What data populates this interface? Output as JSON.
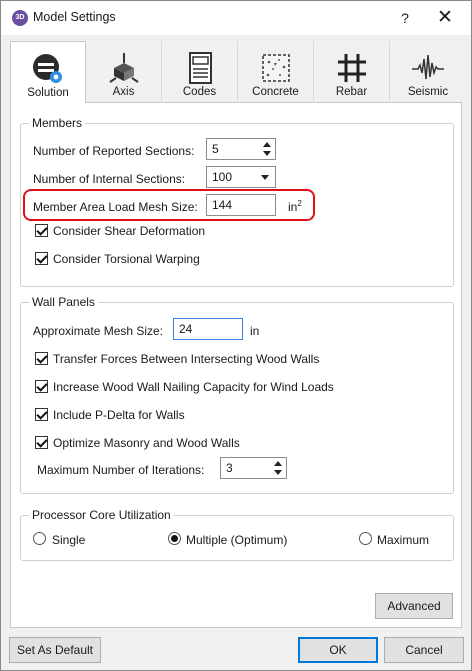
{
  "window": {
    "title": "Model Settings",
    "app_icon_text": "3D",
    "help_glyph": "?",
    "close_glyph": "✕"
  },
  "tabs": [
    {
      "label": "Solution",
      "icon": "solution-gear-icon",
      "active": true
    },
    {
      "label": "Axis",
      "icon": "axis-cube-icon",
      "active": false
    },
    {
      "label": "Codes",
      "icon": "codes-book-icon",
      "active": false
    },
    {
      "label": "Concrete",
      "icon": "concrete-block-icon",
      "active": false
    },
    {
      "label": "Rebar",
      "icon": "rebar-grid-icon",
      "active": false
    },
    {
      "label": "Seismic",
      "icon": "seismic-wave-icon",
      "active": false
    }
  ],
  "members": {
    "legend": "Members",
    "reported_sections_label": "Number of Reported Sections:",
    "reported_sections_value": "5",
    "internal_sections_label": "Number of Internal Sections:",
    "internal_sections_value": "100",
    "mesh_size_label": "Member Area Load Mesh Size:",
    "mesh_size_value": "144",
    "mesh_size_unit": "in",
    "mesh_size_unit_sup": "2",
    "shear_deformation_label": "Consider Shear Deformation",
    "shear_deformation_checked": true,
    "torsional_warping_label": "Consider Torsional Warping",
    "torsional_warping_checked": true
  },
  "wall_panels": {
    "legend": "Wall Panels",
    "mesh_size_label": "Approximate Mesh Size:",
    "mesh_size_value": "24",
    "mesh_size_unit": "in",
    "transfer_forces_label": "Transfer Forces Between Intersecting Wood Walls",
    "increase_nailing_label": "Increase Wood Wall Nailing Capacity for Wind Loads",
    "p_delta_label": "Include P-Delta for Walls",
    "optimize_label": "Optimize Masonry and Wood Walls",
    "max_iterations_label": "Maximum Number of Iterations:",
    "max_iterations_value": "3"
  },
  "processor": {
    "legend": "Processor Core Utilization",
    "options": [
      "Single",
      "Multiple (Optimum)",
      "Maximum"
    ],
    "selected": "Multiple (Optimum)"
  },
  "buttons": {
    "advanced": "Advanced",
    "set_default": "Set As Default",
    "ok": "OK",
    "cancel": "Cancel"
  },
  "colors": {
    "highlight": "#e0101a",
    "focus_border": "#3b7dd8",
    "default_button": "#0078d7",
    "app_icon": "#6b4fa3"
  }
}
